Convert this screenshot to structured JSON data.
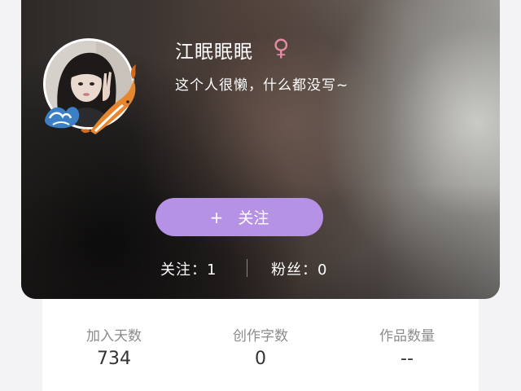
{
  "profile": {
    "name": "江眠眠眠",
    "gender_symbol": "♀",
    "bio": "这个人很懒，什么都没写~"
  },
  "follow_button": {
    "plus": "+",
    "label": "关注"
  },
  "social": {
    "following_label": "关注：",
    "following_count": "1",
    "fans_label": "粉丝：",
    "fans_count": "0"
  },
  "stats": [
    {
      "label": "加入天数",
      "value": "734"
    },
    {
      "label": "创作字数",
      "value": "0"
    },
    {
      "label": "作品数量",
      "value": "--"
    }
  ],
  "colors": {
    "accent": "#b692e6",
    "gender_female": "#e38aa5"
  }
}
